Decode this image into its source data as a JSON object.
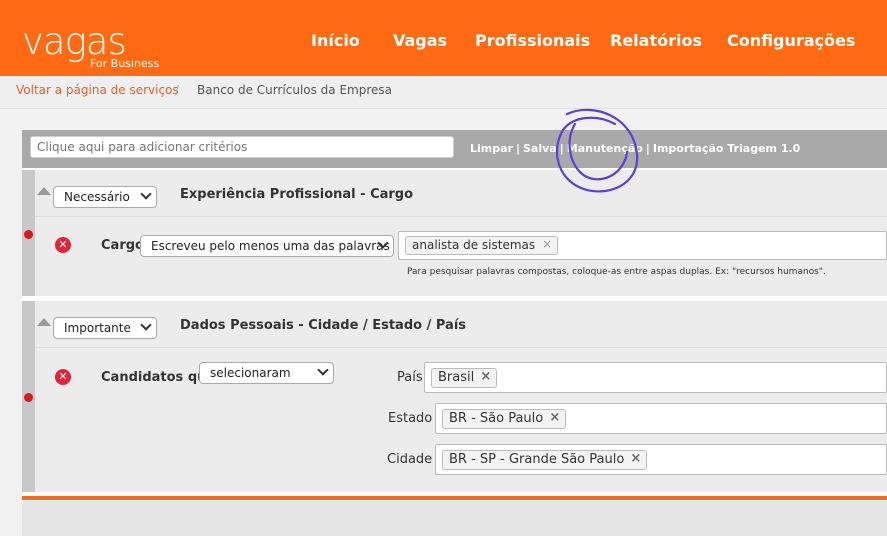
{
  "header": {
    "logo_main": "vagas",
    "logo_sub": "For Business",
    "nav": [
      "Início",
      "Vagas",
      "Profissionais",
      "Relatórios",
      "Configurações"
    ]
  },
  "breadcrumb": {
    "back_link": "Voltar a página de serviços",
    "separator": "/",
    "current": "Banco de Currículos da Empresa"
  },
  "toolbar": {
    "criteria_placeholder": "Clique aqui para adicionar critérios",
    "links": [
      "Limpar",
      "Salva",
      "Manutenção",
      "Importação Triagem 1.0"
    ]
  },
  "blocks": [
    {
      "priority": "Necessário",
      "title": "Experiência Profissional - Cargo",
      "field_label": "Cargo",
      "condition": "Escreveu pelo menos uma das palavras",
      "tags": [
        "analista de sistemas"
      ],
      "hint": "Para pesquisar palavras compostas, coloque-as entre aspas duplas. Ex: \"recursos humanos\"."
    },
    {
      "priority": "Importante",
      "title": "Dados Pessoais - Cidade / Estado / País",
      "field_label": "Candidatos que",
      "condition": "selecionaram",
      "pais_label": "País",
      "pais_tag": "Brasil",
      "estado_label": "Estado",
      "estado_tag": "BR - São Paulo",
      "cidade_label": "Cidade",
      "cidade_tag": "BR - SP - Grande São Paulo"
    }
  ],
  "colors": {
    "brand": "#ff6a13",
    "annotation": "#5b3fd6",
    "remove": "#e0243b"
  }
}
